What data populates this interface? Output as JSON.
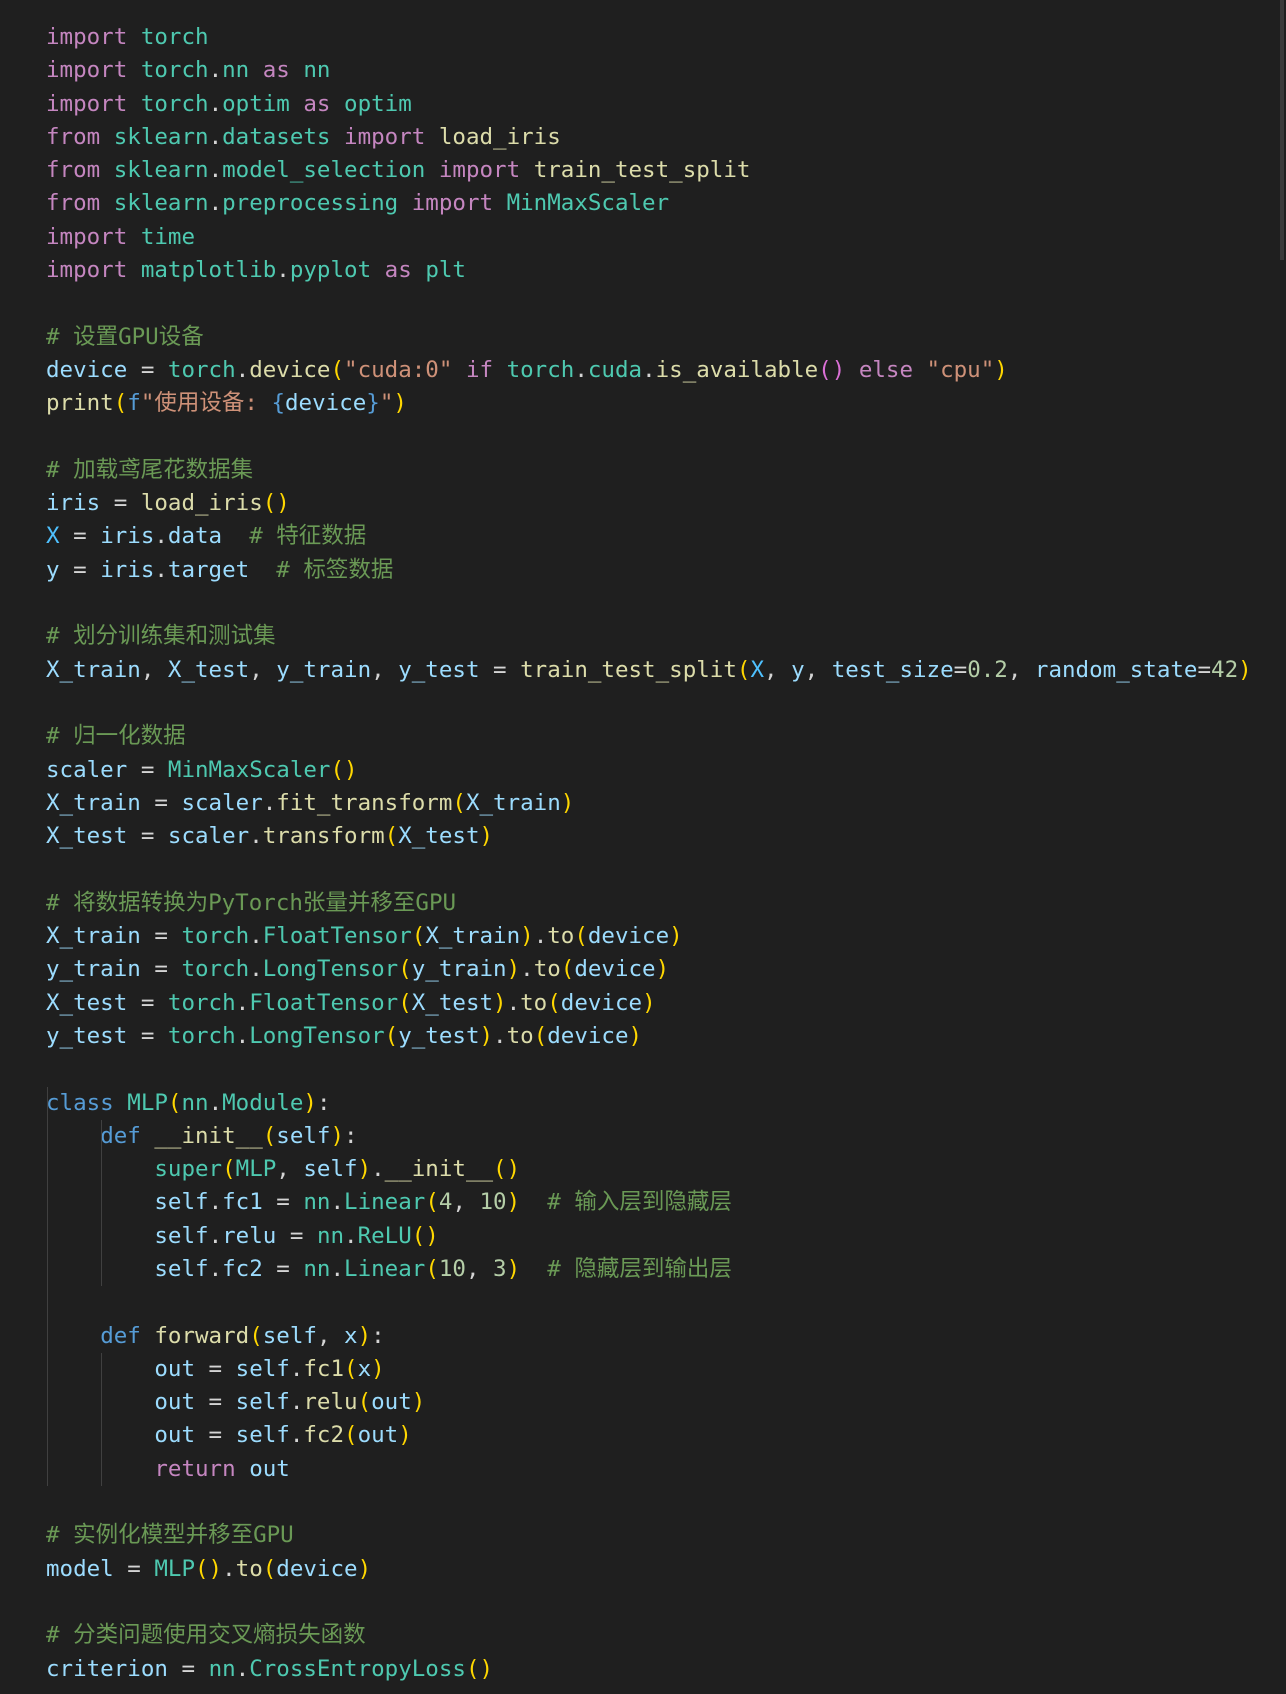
{
  "editor": {
    "language": "python",
    "colors": {
      "background": "#1f1f1f",
      "keyword_control": "#c586c0",
      "keyword": "#569cd6",
      "type": "#4ec9b0",
      "function": "#dcdcaa",
      "variable": "#9cdcfe",
      "constant": "#4fc1ff",
      "string": "#ce9178",
      "number": "#b5cea8",
      "comment": "#6a9955",
      "bracket_level_1": "#ffd700",
      "bracket_level_2": "#da70d6",
      "bracket_level_3": "#179fff"
    },
    "lines": [
      [
        [
          "kw-import",
          "import"
        ],
        [
          "op",
          " "
        ],
        [
          "mod",
          "torch"
        ]
      ],
      [
        [
          "kw-import",
          "import"
        ],
        [
          "op",
          " "
        ],
        [
          "mod",
          "torch"
        ],
        [
          "op",
          "."
        ],
        [
          "mod",
          "nn"
        ],
        [
          "op",
          " "
        ],
        [
          "kw-import",
          "as"
        ],
        [
          "op",
          " "
        ],
        [
          "mod",
          "nn"
        ]
      ],
      [
        [
          "kw-import",
          "import"
        ],
        [
          "op",
          " "
        ],
        [
          "mod",
          "torch"
        ],
        [
          "op",
          "."
        ],
        [
          "mod",
          "optim"
        ],
        [
          "op",
          " "
        ],
        [
          "kw-import",
          "as"
        ],
        [
          "op",
          " "
        ],
        [
          "mod",
          "optim"
        ]
      ],
      [
        [
          "kw-import",
          "from"
        ],
        [
          "op",
          " "
        ],
        [
          "mod",
          "sklearn"
        ],
        [
          "op",
          "."
        ],
        [
          "mod",
          "datasets"
        ],
        [
          "op",
          " "
        ],
        [
          "kw-import",
          "import"
        ],
        [
          "op",
          " "
        ],
        [
          "fn",
          "load_iris"
        ]
      ],
      [
        [
          "kw-import",
          "from"
        ],
        [
          "op",
          " "
        ],
        [
          "mod",
          "sklearn"
        ],
        [
          "op",
          "."
        ],
        [
          "mod",
          "model_selection"
        ],
        [
          "op",
          " "
        ],
        [
          "kw-import",
          "import"
        ],
        [
          "op",
          " "
        ],
        [
          "fn",
          "train_test_split"
        ]
      ],
      [
        [
          "kw-import",
          "from"
        ],
        [
          "op",
          " "
        ],
        [
          "mod",
          "sklearn"
        ],
        [
          "op",
          "."
        ],
        [
          "mod",
          "preprocessing"
        ],
        [
          "op",
          " "
        ],
        [
          "kw-import",
          "import"
        ],
        [
          "op",
          " "
        ],
        [
          "mod",
          "MinMaxScaler"
        ]
      ],
      [
        [
          "kw-import",
          "import"
        ],
        [
          "op",
          " "
        ],
        [
          "mod",
          "time"
        ]
      ],
      [
        [
          "kw-import",
          "import"
        ],
        [
          "op",
          " "
        ],
        [
          "mod",
          "matplotlib"
        ],
        [
          "op",
          "."
        ],
        [
          "mod",
          "pyplot"
        ],
        [
          "op",
          " "
        ],
        [
          "kw-import",
          "as"
        ],
        [
          "op",
          " "
        ],
        [
          "mod",
          "plt"
        ]
      ],
      [],
      [
        [
          "cm",
          "# 设置GPU设备"
        ]
      ],
      [
        [
          "var",
          "device"
        ],
        [
          "op",
          " = "
        ],
        [
          "mod",
          "torch"
        ],
        [
          "op",
          "."
        ],
        [
          "fn",
          "device"
        ],
        [
          "p1",
          "("
        ],
        [
          "str",
          "\"cuda:0\""
        ],
        [
          "op",
          " "
        ],
        [
          "kw-import",
          "if"
        ],
        [
          "op",
          " "
        ],
        [
          "mod",
          "torch"
        ],
        [
          "op",
          "."
        ],
        [
          "mod",
          "cuda"
        ],
        [
          "op",
          "."
        ],
        [
          "fn",
          "is_available"
        ],
        [
          "p2",
          "()"
        ],
        [
          "op",
          " "
        ],
        [
          "kw-import",
          "else"
        ],
        [
          "op",
          " "
        ],
        [
          "str",
          "\"cpu\""
        ],
        [
          "p1",
          ")"
        ]
      ],
      [
        [
          "fn",
          "print"
        ],
        [
          "p1",
          "("
        ],
        [
          "kw",
          "f"
        ],
        [
          "str",
          "\"使用设备: "
        ],
        [
          "kw",
          "{"
        ],
        [
          "var",
          "device"
        ],
        [
          "kw",
          "}"
        ],
        [
          "str",
          "\""
        ],
        [
          "p1",
          ")"
        ]
      ],
      [],
      [
        [
          "cm",
          "# 加载鸢尾花数据集"
        ]
      ],
      [
        [
          "var",
          "iris"
        ],
        [
          "op",
          " = "
        ],
        [
          "fn",
          "load_iris"
        ],
        [
          "p1",
          "()"
        ]
      ],
      [
        [
          "const",
          "X"
        ],
        [
          "op",
          " = "
        ],
        [
          "var",
          "iris"
        ],
        [
          "op",
          "."
        ],
        [
          "var",
          "data"
        ],
        [
          "op",
          "  "
        ],
        [
          "cm",
          "# 特征数据"
        ]
      ],
      [
        [
          "var",
          "y"
        ],
        [
          "op",
          " = "
        ],
        [
          "var",
          "iris"
        ],
        [
          "op",
          "."
        ],
        [
          "var",
          "target"
        ],
        [
          "op",
          "  "
        ],
        [
          "cm",
          "# 标签数据"
        ]
      ],
      [],
      [
        [
          "cm",
          "# 划分训练集和测试集"
        ]
      ],
      [
        [
          "var",
          "X_train"
        ],
        [
          "op",
          ", "
        ],
        [
          "var",
          "X_test"
        ],
        [
          "op",
          ", "
        ],
        [
          "var",
          "y_train"
        ],
        [
          "op",
          ", "
        ],
        [
          "var",
          "y_test"
        ],
        [
          "op",
          " = "
        ],
        [
          "fn",
          "train_test_split"
        ],
        [
          "p1",
          "("
        ],
        [
          "const",
          "X"
        ],
        [
          "op",
          ", "
        ],
        [
          "var",
          "y"
        ],
        [
          "op",
          ", "
        ],
        [
          "var",
          "test_size"
        ],
        [
          "op",
          "="
        ],
        [
          "num",
          "0.2"
        ],
        [
          "op",
          ", "
        ],
        [
          "var",
          "random_state"
        ],
        [
          "op",
          "="
        ],
        [
          "num",
          "42"
        ],
        [
          "p1",
          ")"
        ]
      ],
      [],
      [
        [
          "cm",
          "# 归一化数据"
        ]
      ],
      [
        [
          "var",
          "scaler"
        ],
        [
          "op",
          " = "
        ],
        [
          "mod",
          "MinMaxScaler"
        ],
        [
          "p1",
          "()"
        ]
      ],
      [
        [
          "var",
          "X_train"
        ],
        [
          "op",
          " = "
        ],
        [
          "var",
          "scaler"
        ],
        [
          "op",
          "."
        ],
        [
          "fn",
          "fit_transform"
        ],
        [
          "p1",
          "("
        ],
        [
          "var",
          "X_train"
        ],
        [
          "p1",
          ")"
        ]
      ],
      [
        [
          "var",
          "X_test"
        ],
        [
          "op",
          " = "
        ],
        [
          "var",
          "scaler"
        ],
        [
          "op",
          "."
        ],
        [
          "fn",
          "transform"
        ],
        [
          "p1",
          "("
        ],
        [
          "var",
          "X_test"
        ],
        [
          "p1",
          ")"
        ]
      ],
      [],
      [
        [
          "cm",
          "# 将数据转换为PyTorch张量并移至GPU"
        ]
      ],
      [
        [
          "var",
          "X_train"
        ],
        [
          "op",
          " = "
        ],
        [
          "mod",
          "torch"
        ],
        [
          "op",
          "."
        ],
        [
          "mod",
          "FloatTensor"
        ],
        [
          "p1",
          "("
        ],
        [
          "var",
          "X_train"
        ],
        [
          "p1",
          ")"
        ],
        [
          "op",
          "."
        ],
        [
          "fn",
          "to"
        ],
        [
          "p1",
          "("
        ],
        [
          "var",
          "device"
        ],
        [
          "p1",
          ")"
        ]
      ],
      [
        [
          "var",
          "y_train"
        ],
        [
          "op",
          " = "
        ],
        [
          "mod",
          "torch"
        ],
        [
          "op",
          "."
        ],
        [
          "mod",
          "LongTensor"
        ],
        [
          "p1",
          "("
        ],
        [
          "var",
          "y_train"
        ],
        [
          "p1",
          ")"
        ],
        [
          "op",
          "."
        ],
        [
          "fn",
          "to"
        ],
        [
          "p1",
          "("
        ],
        [
          "var",
          "device"
        ],
        [
          "p1",
          ")"
        ]
      ],
      [
        [
          "var",
          "X_test"
        ],
        [
          "op",
          " = "
        ],
        [
          "mod",
          "torch"
        ],
        [
          "op",
          "."
        ],
        [
          "mod",
          "FloatTensor"
        ],
        [
          "p1",
          "("
        ],
        [
          "var",
          "X_test"
        ],
        [
          "p1",
          ")"
        ],
        [
          "op",
          "."
        ],
        [
          "fn",
          "to"
        ],
        [
          "p1",
          "("
        ],
        [
          "var",
          "device"
        ],
        [
          "p1",
          ")"
        ]
      ],
      [
        [
          "var",
          "y_test"
        ],
        [
          "op",
          " = "
        ],
        [
          "mod",
          "torch"
        ],
        [
          "op",
          "."
        ],
        [
          "mod",
          "LongTensor"
        ],
        [
          "p1",
          "("
        ],
        [
          "var",
          "y_test"
        ],
        [
          "p1",
          ")"
        ],
        [
          "op",
          "."
        ],
        [
          "fn",
          "to"
        ],
        [
          "p1",
          "("
        ],
        [
          "var",
          "device"
        ],
        [
          "p1",
          ")"
        ]
      ],
      [],
      [
        [
          "kw",
          "class"
        ],
        [
          "op",
          " "
        ],
        [
          "mod",
          "MLP"
        ],
        [
          "p1",
          "("
        ],
        [
          "mod",
          "nn"
        ],
        [
          "op",
          "."
        ],
        [
          "mod",
          "Module"
        ],
        [
          "p1",
          ")"
        ],
        [
          "op",
          ":"
        ]
      ],
      [
        [
          "op",
          "    "
        ],
        [
          "kw",
          "def"
        ],
        [
          "op",
          " "
        ],
        [
          "fn",
          "__init__"
        ],
        [
          "p1",
          "("
        ],
        [
          "var",
          "self"
        ],
        [
          "p1",
          ")"
        ],
        [
          "op",
          ":"
        ]
      ],
      [
        [
          "op",
          "        "
        ],
        [
          "mod",
          "super"
        ],
        [
          "p1",
          "("
        ],
        [
          "mod",
          "MLP"
        ],
        [
          "op",
          ", "
        ],
        [
          "var",
          "self"
        ],
        [
          "p1",
          ")"
        ],
        [
          "op",
          "."
        ],
        [
          "fn",
          "__init__"
        ],
        [
          "p1",
          "()"
        ]
      ],
      [
        [
          "op",
          "        "
        ],
        [
          "var",
          "self"
        ],
        [
          "op",
          "."
        ],
        [
          "var",
          "fc1"
        ],
        [
          "op",
          " = "
        ],
        [
          "mod",
          "nn"
        ],
        [
          "op",
          "."
        ],
        [
          "mod",
          "Linear"
        ],
        [
          "p1",
          "("
        ],
        [
          "num",
          "4"
        ],
        [
          "op",
          ", "
        ],
        [
          "num",
          "10"
        ],
        [
          "p1",
          ")"
        ],
        [
          "op",
          "  "
        ],
        [
          "cm",
          "# 输入层到隐藏层"
        ]
      ],
      [
        [
          "op",
          "        "
        ],
        [
          "var",
          "self"
        ],
        [
          "op",
          "."
        ],
        [
          "var",
          "relu"
        ],
        [
          "op",
          " = "
        ],
        [
          "mod",
          "nn"
        ],
        [
          "op",
          "."
        ],
        [
          "mod",
          "ReLU"
        ],
        [
          "p1",
          "()"
        ]
      ],
      [
        [
          "op",
          "        "
        ],
        [
          "var",
          "self"
        ],
        [
          "op",
          "."
        ],
        [
          "var",
          "fc2"
        ],
        [
          "op",
          " = "
        ],
        [
          "mod",
          "nn"
        ],
        [
          "op",
          "."
        ],
        [
          "mod",
          "Linear"
        ],
        [
          "p1",
          "("
        ],
        [
          "num",
          "10"
        ],
        [
          "op",
          ", "
        ],
        [
          "num",
          "3"
        ],
        [
          "p1",
          ")"
        ],
        [
          "op",
          "  "
        ],
        [
          "cm",
          "# 隐藏层到输出层"
        ]
      ],
      [],
      [
        [
          "op",
          "    "
        ],
        [
          "kw",
          "def"
        ],
        [
          "op",
          " "
        ],
        [
          "fn",
          "forward"
        ],
        [
          "p1",
          "("
        ],
        [
          "var",
          "self"
        ],
        [
          "op",
          ", "
        ],
        [
          "var",
          "x"
        ],
        [
          "p1",
          ")"
        ],
        [
          "op",
          ":"
        ]
      ],
      [
        [
          "op",
          "        "
        ],
        [
          "var",
          "out"
        ],
        [
          "op",
          " = "
        ],
        [
          "var",
          "self"
        ],
        [
          "op",
          "."
        ],
        [
          "fn",
          "fc1"
        ],
        [
          "p1",
          "("
        ],
        [
          "var",
          "x"
        ],
        [
          "p1",
          ")"
        ]
      ],
      [
        [
          "op",
          "        "
        ],
        [
          "var",
          "out"
        ],
        [
          "op",
          " = "
        ],
        [
          "var",
          "self"
        ],
        [
          "op",
          "."
        ],
        [
          "fn",
          "relu"
        ],
        [
          "p1",
          "("
        ],
        [
          "var",
          "out"
        ],
        [
          "p1",
          ")"
        ]
      ],
      [
        [
          "op",
          "        "
        ],
        [
          "var",
          "out"
        ],
        [
          "op",
          " = "
        ],
        [
          "var",
          "self"
        ],
        [
          "op",
          "."
        ],
        [
          "fn",
          "fc2"
        ],
        [
          "p1",
          "("
        ],
        [
          "var",
          "out"
        ],
        [
          "p1",
          ")"
        ]
      ],
      [
        [
          "op",
          "        "
        ],
        [
          "kw-import",
          "return"
        ],
        [
          "op",
          " "
        ],
        [
          "var",
          "out"
        ]
      ],
      [],
      [
        [
          "cm",
          "# 实例化模型并移至GPU"
        ]
      ],
      [
        [
          "var",
          "model"
        ],
        [
          "op",
          " = "
        ],
        [
          "mod",
          "MLP"
        ],
        [
          "p1",
          "()"
        ],
        [
          "op",
          "."
        ],
        [
          "fn",
          "to"
        ],
        [
          "p1",
          "("
        ],
        [
          "var",
          "device"
        ],
        [
          "p1",
          ")"
        ]
      ],
      [],
      [
        [
          "cm",
          "# 分类问题使用交叉熵损失函数"
        ]
      ],
      [
        [
          "var",
          "criterion"
        ],
        [
          "op",
          " = "
        ],
        [
          "mod",
          "nn"
        ],
        [
          "op",
          "."
        ],
        [
          "mod",
          "CrossEntropyLoss"
        ],
        [
          "p1",
          "()"
        ]
      ]
    ],
    "guides": {
      "32": [
        1
      ],
      "33": [
        1,
        2
      ],
      "34": [
        1,
        2
      ],
      "35": [
        1,
        2
      ],
      "36": [
        1,
        2
      ],
      "37": [
        1,
        2
      ],
      "38": [
        1
      ],
      "39": [
        1
      ],
      "40": [
        1,
        2
      ],
      "41": [
        1,
        2
      ],
      "42": [
        1,
        2
      ],
      "43": [
        1,
        2
      ]
    }
  }
}
